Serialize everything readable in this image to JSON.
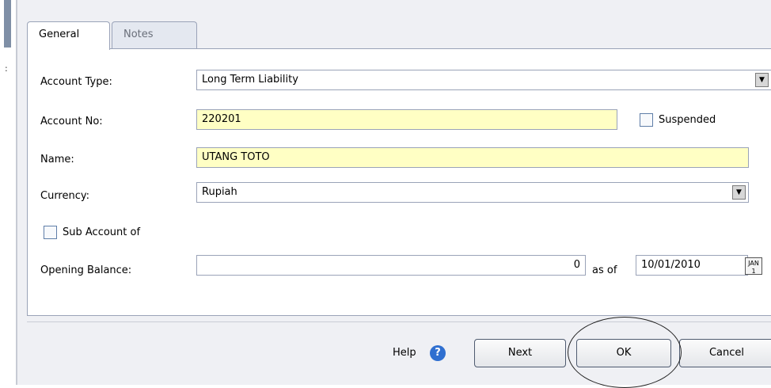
{
  "tabs": [
    {
      "label": "General",
      "active": true
    },
    {
      "label": "Notes",
      "active": false
    }
  ],
  "form": {
    "account_type": {
      "label": "Account Type:",
      "value": "Long Term Liability"
    },
    "account_no": {
      "label": "Account No:",
      "value": "220201"
    },
    "suspended": {
      "label": "Suspended",
      "checked": false
    },
    "name": {
      "label": "Name:",
      "value": "UTANG TOTO"
    },
    "currency": {
      "label": "Currency:",
      "value": "Rupiah"
    },
    "sub_account": {
      "label": "Sub Account of",
      "checked": false
    },
    "opening_balance": {
      "label": "Opening Balance:",
      "value": "0",
      "as_of_label": "as of",
      "date": "10/01/2010"
    }
  },
  "footer": {
    "help_label": "Help",
    "next_label": "Next",
    "ok_label": "OK",
    "cancel_label": "Cancel"
  },
  "colors": {
    "required_field": "#ffffc4",
    "help_icon": "#2f6fd0"
  },
  "icons": [
    "help-icon",
    "calendar-icon",
    "dropdown-arrow-icon"
  ]
}
